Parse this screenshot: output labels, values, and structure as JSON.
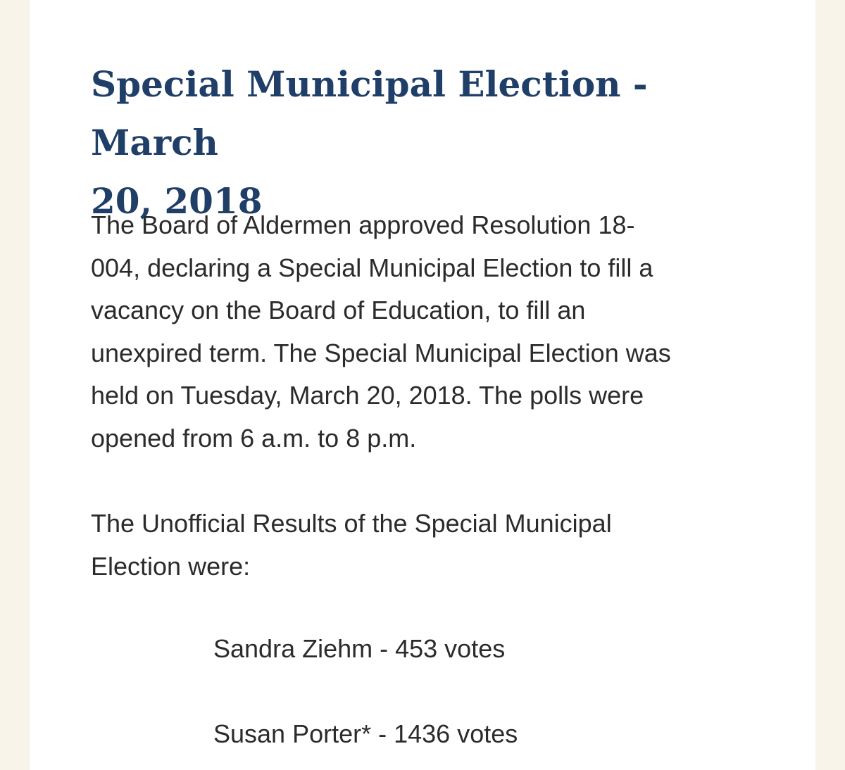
{
  "title": "Special Municipal Election - March\n20, 2018",
  "intro": "The Board of Aldermen approved Resolution 18-\n004, declaring a Special Municipal Election to fill a\nvacancy on the Board of Education, to fill an\nunexpired term.  The Special Municipal Election was\nheld on Tuesday, March 20, 2018.  The polls were\nopened from 6 a.m. to 8 p.m.",
  "results_intro": "The Unofficial Results of the Special Municipal\nElection were:",
  "results": [
    {
      "text": "Sandra Ziehm - 453 votes"
    },
    {
      "text": "Susan Porter* - 1436 votes"
    }
  ]
}
